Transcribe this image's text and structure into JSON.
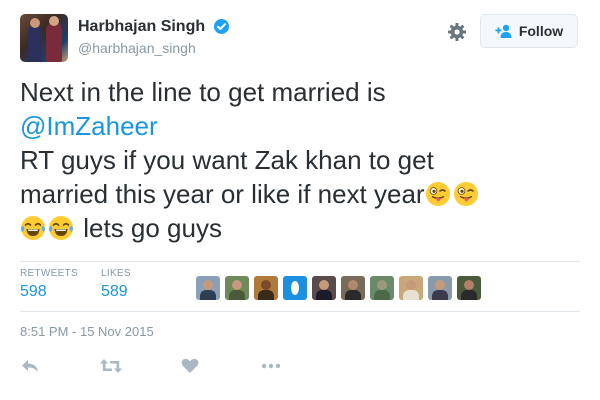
{
  "user": {
    "display_name": "Harbhajan Singh",
    "handle": "@harbhajan_singh",
    "verified": true
  },
  "follow_button": {
    "label": "Follow"
  },
  "tweet": {
    "line1": "Next in the line to get married is",
    "mention": "@ImZaheer",
    "line3": "RT guys if you want Zak khan to get",
    "line4": "married this year or like if next year",
    "line5_text": "lets go guys",
    "emojis": [
      "winking-tongue-face",
      "winking-tongue-face",
      "tears-of-joy-face",
      "tears-of-joy-face"
    ]
  },
  "stats": {
    "retweets_label": "RETWEETS",
    "retweets_value": "598",
    "likes_label": "LIKES",
    "likes_value": "589"
  },
  "timestamp": "8:51 PM - 15 Nov 2015",
  "icons": [
    "verified-badge-icon",
    "gear-icon",
    "follow-user-icon",
    "reply-icon",
    "retweet-icon",
    "like-heart-icon",
    "more-icon"
  ],
  "colors": {
    "text": "#292f33",
    "muted": "#8899a6",
    "link": "#1b95e0",
    "verified": "#1da1f2",
    "border": "#e1e8ed",
    "emoji_yellow": "#ffcc33"
  }
}
